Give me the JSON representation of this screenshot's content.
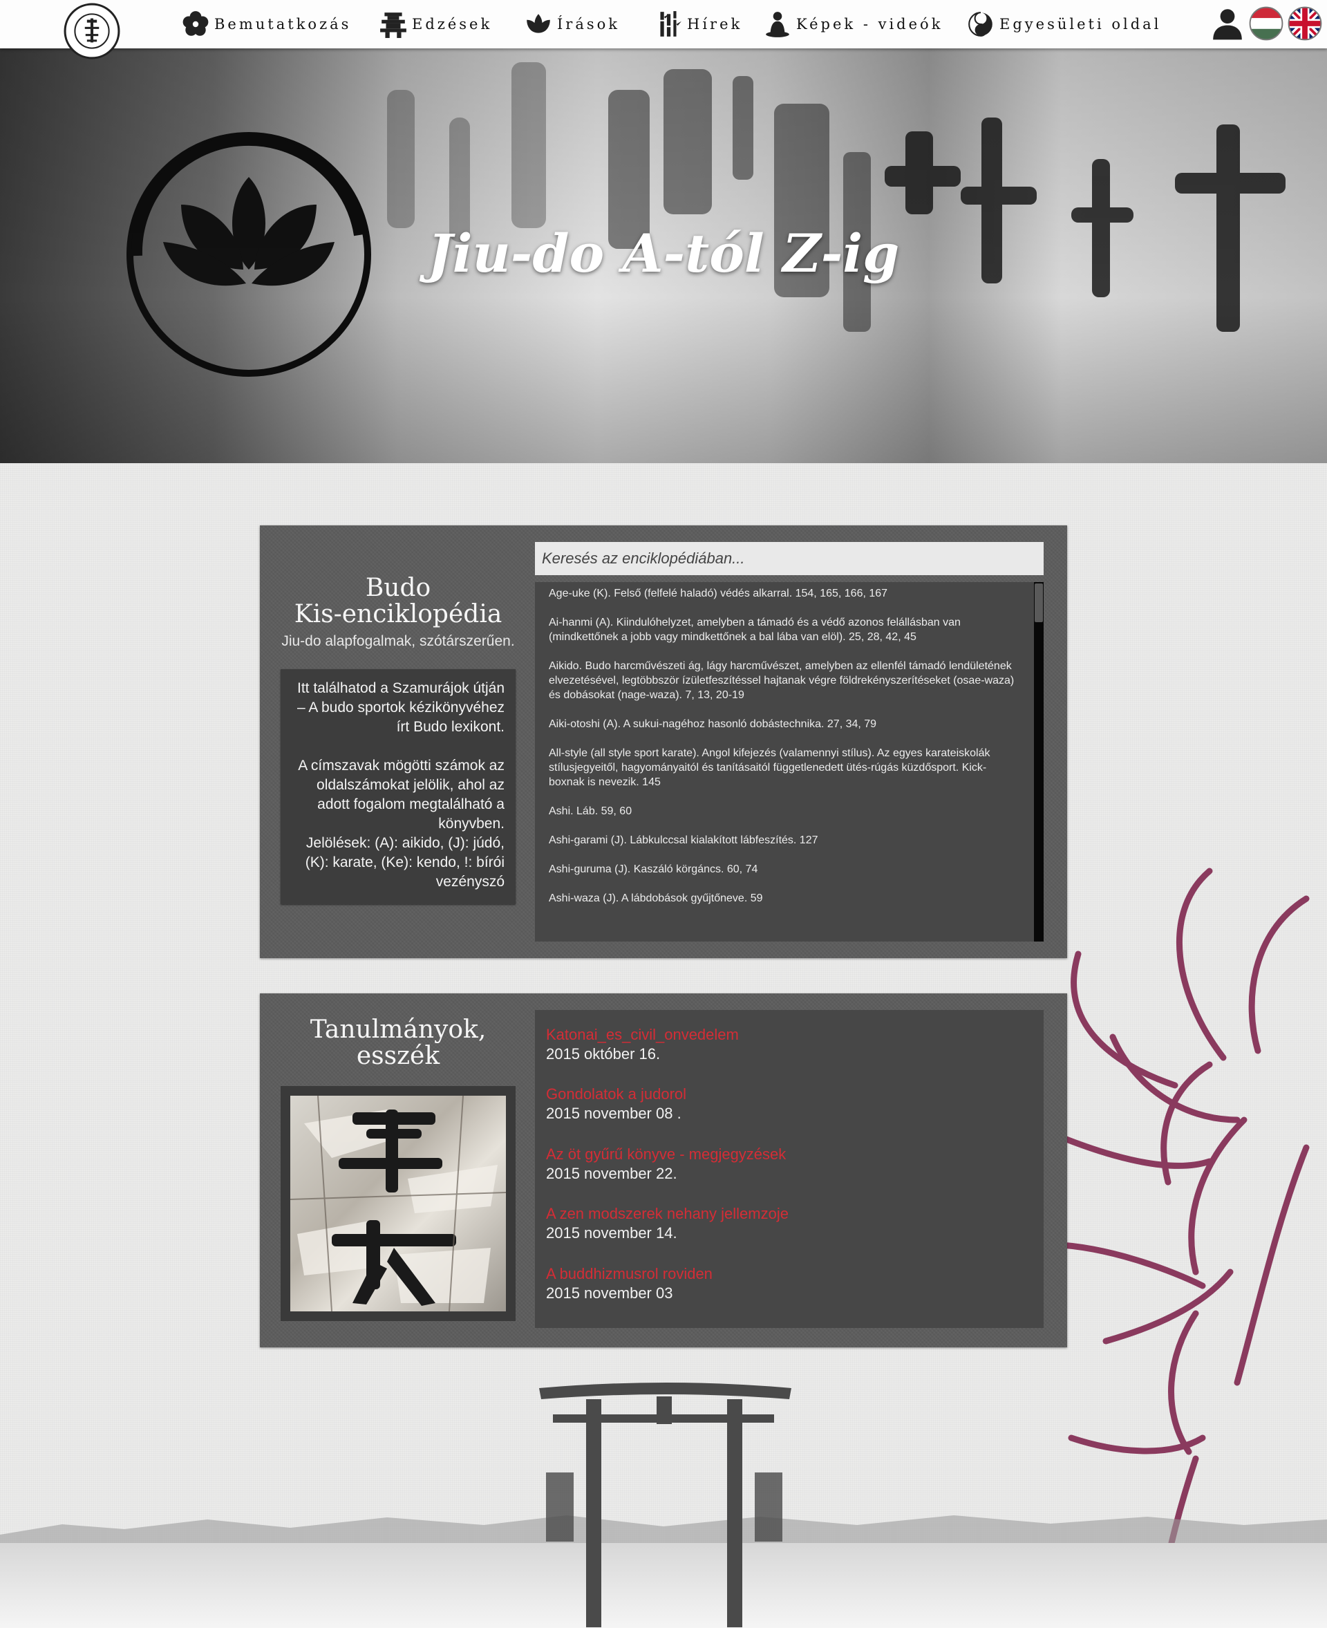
{
  "nav": {
    "items": [
      {
        "label": "Bemutatkozás",
        "icon": "sakura-icon"
      },
      {
        "label": "Edzések",
        "icon": "pagoda-icon"
      },
      {
        "label": "Írások",
        "icon": "lotus-icon"
      },
      {
        "label": "Hírek",
        "icon": "bamboo-icon"
      },
      {
        "label": "Képek - videók",
        "icon": "buddha-icon"
      },
      {
        "label": "Egyesületi oldal",
        "icon": "koi-icon"
      }
    ],
    "right_icons": [
      "user-icon",
      "hungarian-flag-icon",
      "uk-flag-icon"
    ]
  },
  "hero": {
    "title": "Jiu-do A-tól Z-ig"
  },
  "encyclopedia": {
    "title_line1": "Budo",
    "title_line2": "Kis-enciklopédia",
    "subtitle": "Jiu-do alapfogalmak, szótárszerűen.",
    "info_paragraphs": [
      "Itt találhatod a Szamurájok útján – A budo sportok kézikönyvéhez írt Budo lexikont.",
      "A címszavak mögötti számok az oldalszámokat jelölik, ahol az adott fogalom megtalálható a könyvben.",
      "Jelölések: (A): aikido, (J): júdó, (K): karate, (Ke): kendo, !: bírói vezényszó"
    ],
    "search_placeholder": "Keresés az enciklopédiában...",
    "entries": [
      "Age-uke (K). Felső (felfelé haladó) védés alkarral. 154, 165, 166, 167",
      "Ai-hanmi (A). Kiindulóhelyzet, amelyben a támadó és a védő azonos felállásban van (mindkettőnek a jobb vagy mindkettőnek a bal lába van elöl). 25, 28, 42, 45",
      "Aikido. Budo harcművészeti ág, lágy harcművészet, amelyben az ellenfél támadó lendületének elvezetésével, legtöbbször ízületfeszítéssel hajtanak végre földrekényszerítéseket (osae-waza) és dobásokat (nage-waza). 7, 13, 20-19",
      "Aiki-otoshi (A). A sukui-nagéhoz hasonló dobástechnika. 27, 34, 79",
      "All-style (all style sport karate). Angol kifejezés (valamennyi stílus). Az egyes karateiskolák stílusjegyeitől, hagyományaitól és tanításaitól függetlenedett ütés-rúgás küzdősport. Kick-boxnak is nevezik. 145",
      "Ashi. Láb. 59, 60",
      "Ashi-garami (J). Lábkulccsal kialakított lábfeszítés. 127",
      "Ashi-guruma (J). Kaszáló körgáncs. 60, 74",
      "Ashi-waza (J). A lábdobások gyűjtőneve. 59"
    ]
  },
  "essays": {
    "title_line1": "Tanulmányok,",
    "title_line2": "esszék",
    "items": [
      {
        "title": "Katonai_es_civil_onvedelem",
        "date": "2015 október 16."
      },
      {
        "title": "Gondolatok a judorol",
        "date": "2015 november 08 ."
      },
      {
        "title": "Az öt gyűrű könyve - megjegyzések",
        "date": "2015 november 22."
      },
      {
        "title": "A zen modszerek nehany jellemzoje",
        "date": "2015 november 14."
      },
      {
        "title": "A buddhizmusrol roviden",
        "date": "2015 november 03"
      }
    ]
  },
  "colors": {
    "accent_red": "#d42d36",
    "lotus_purple": "#8a3a5e",
    "panel_gray": "#5d5d5d"
  }
}
